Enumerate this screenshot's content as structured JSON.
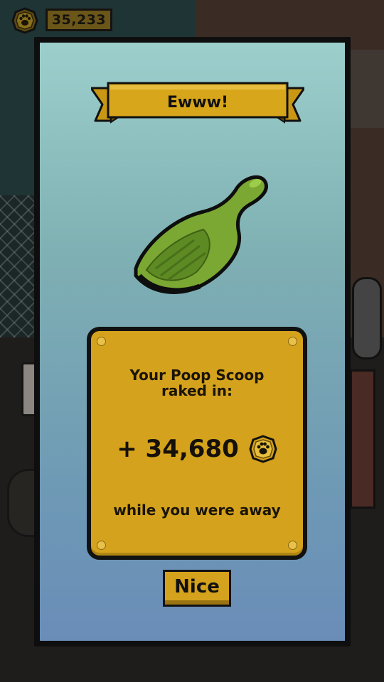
{
  "hud": {
    "coin_icon": "paw-coin-icon",
    "currency_count": "35,233"
  },
  "dialog": {
    "title": "Ewww!",
    "item_icon": "poop-scoop-icon",
    "message_line1": "Your Poop Scoop",
    "message_line2": "raked in:",
    "reward_amount": "+ 34,680",
    "reward_icon": "paw-coin-icon",
    "away_text": "while you were away",
    "confirm_label": "Nice"
  },
  "colors": {
    "gold": "#d4a21c",
    "scoop_green": "#7aa832",
    "dialog_top": "#9ccfcc",
    "dialog_bottom": "#6a8db8",
    "outline": "#111111"
  }
}
